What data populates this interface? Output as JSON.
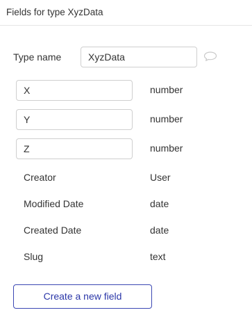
{
  "header": {
    "title": "Fields for type XyzData"
  },
  "type_name": {
    "label": "Type name",
    "value": "XyzData",
    "comment_icon": "comment-bubble-icon"
  },
  "fields": [
    {
      "name": "X",
      "type": "number"
    },
    {
      "name": "Y",
      "type": "number"
    },
    {
      "name": "Z",
      "type": "number"
    }
  ],
  "builtin_fields": [
    {
      "name": "Creator",
      "type": "User"
    },
    {
      "name": "Modified Date",
      "type": "date"
    },
    {
      "name": "Created Date",
      "type": "date"
    },
    {
      "name": "Slug",
      "type": "text"
    }
  ],
  "create_button": {
    "label": "Create a new field",
    "color": "#2b37a8"
  }
}
